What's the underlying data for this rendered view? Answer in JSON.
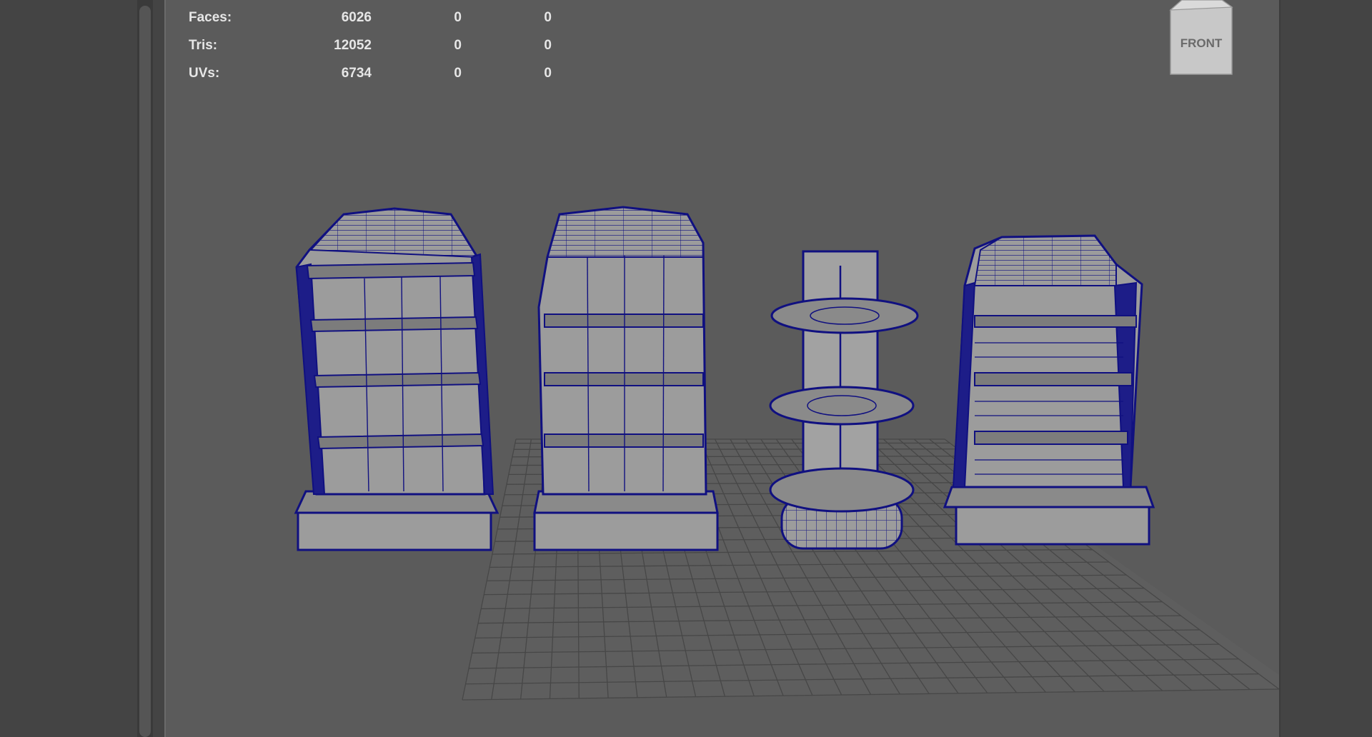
{
  "hud": {
    "rows": [
      {
        "label": "Faces:",
        "v1": "6026",
        "v2": "0",
        "v3": "0"
      },
      {
        "label": "Tris:",
        "v1": "12052",
        "v2": "0",
        "v3": "0"
      },
      {
        "label": "UVs:",
        "v1": "6734",
        "v2": "0",
        "v3": "0"
      }
    ]
  },
  "viewcube": {
    "label": "FRONT"
  },
  "colors": {
    "viewport_bg": "#5b5b5b",
    "wireframe": "#101080",
    "mesh_fill": "#9c9c9c",
    "grid": "#4a4a4a"
  }
}
